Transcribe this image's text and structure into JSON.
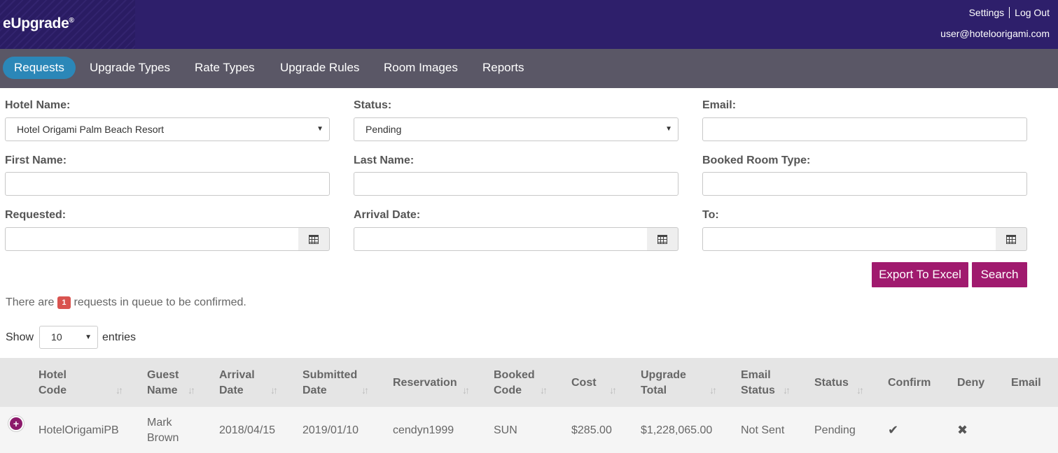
{
  "brand": {
    "name": "eUpgrade",
    "mark": "®"
  },
  "header": {
    "settings": "Settings",
    "logout": "Log Out",
    "user_email": "user@hoteloorigami.com"
  },
  "nav": {
    "items": [
      {
        "label": "Requests",
        "active": true
      },
      {
        "label": "Upgrade Types",
        "active": false
      },
      {
        "label": "Rate Types",
        "active": false
      },
      {
        "label": "Upgrade Rules",
        "active": false
      },
      {
        "label": "Room Images",
        "active": false
      },
      {
        "label": "Reports",
        "active": false
      }
    ]
  },
  "form": {
    "hotel_name": {
      "label": "Hotel Name:",
      "value": "Hotel Origami Palm Beach Resort"
    },
    "status": {
      "label": "Status:",
      "value": "Pending"
    },
    "email": {
      "label": "Email:",
      "value": ""
    },
    "first_name": {
      "label": "First Name:",
      "value": ""
    },
    "last_name": {
      "label": "Last Name:",
      "value": ""
    },
    "booked_room_type": {
      "label": "Booked Room Type:",
      "value": ""
    },
    "requested": {
      "label": "Requested:",
      "value": ""
    },
    "arrival_date": {
      "label": "Arrival Date:",
      "value": ""
    },
    "to": {
      "label": "To:",
      "value": ""
    }
  },
  "buttons": {
    "export": "Export To Excel",
    "search": "Search"
  },
  "queue": {
    "prefix": "There are",
    "count": "1",
    "suffix": "requests in queue to be confirmed."
  },
  "entries": {
    "show": "Show",
    "value": "10",
    "suffix": "entries"
  },
  "table": {
    "columns": [
      {
        "line1": "Hotel",
        "line2": "Code"
      },
      {
        "line1": "Guest",
        "line2": "Name"
      },
      {
        "line1": "Arrival",
        "line2": "Date"
      },
      {
        "line1": "Submitted",
        "line2": "Date"
      },
      {
        "line1": "Reservation",
        "line2": ""
      },
      {
        "line1": "Booked",
        "line2": "Code"
      },
      {
        "line1": "Cost",
        "line2": ""
      },
      {
        "line1": "Upgrade",
        "line2": "Total"
      },
      {
        "line1": "Email",
        "line2": "Status"
      },
      {
        "line1": "Status",
        "line2": ""
      },
      {
        "line1": "Confirm",
        "line2": ""
      },
      {
        "line1": "Deny",
        "line2": ""
      },
      {
        "line1": "Email",
        "line2": ""
      }
    ],
    "rows": [
      {
        "hotel_code": "HotelOrigamiPB",
        "guest_first": "Mark",
        "guest_last": "Brown",
        "arrival_date": "2018/04/15",
        "submitted_date": "2019/01/10",
        "reservation": "cendyn1999",
        "booked_code": "SUN",
        "cost": "$285.00",
        "upgrade_total": "$1,228,065.00",
        "email_status": "Not Sent",
        "status": "Pending",
        "confirm_icon": "check-icon",
        "deny_icon": "x-icon"
      }
    ]
  },
  "colors": {
    "header": "#2e1f6b",
    "nav": "#5a5766",
    "active_tab": "#2b87b8",
    "button": "#a01a6e",
    "badge": "#d9534f"
  }
}
